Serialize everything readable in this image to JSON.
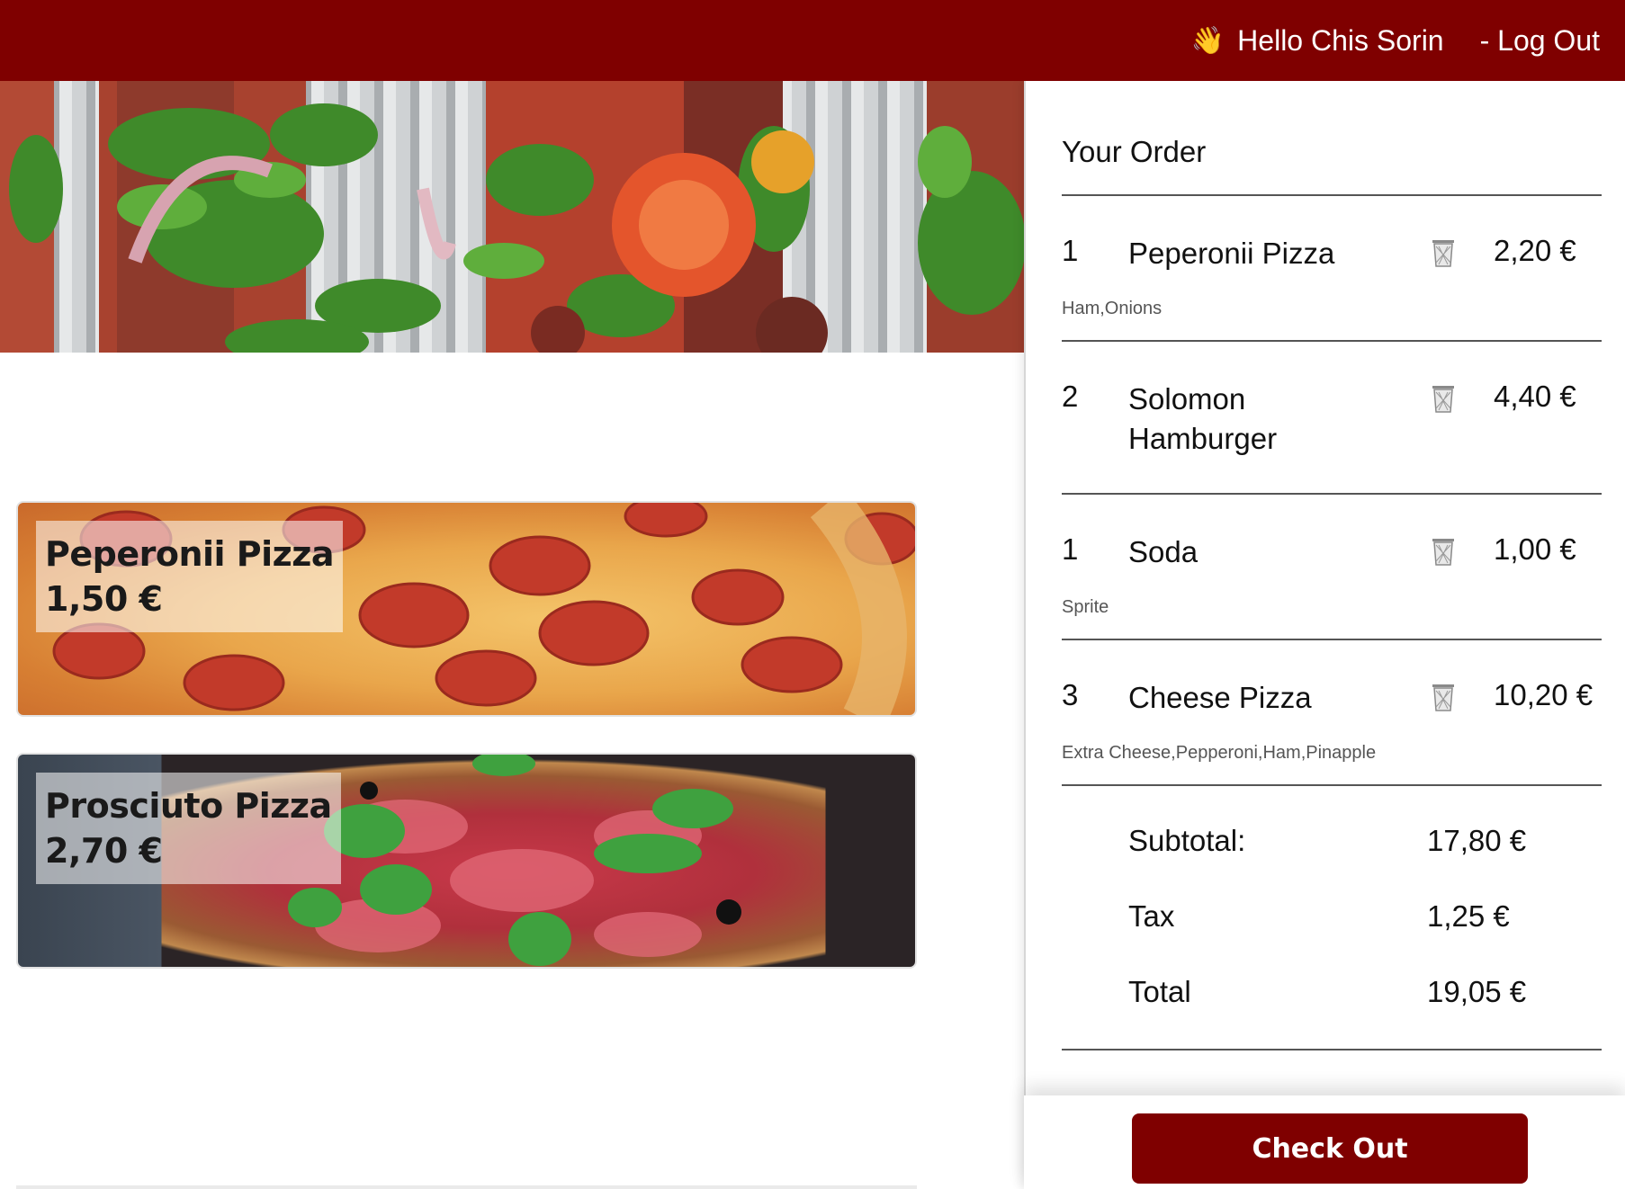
{
  "header": {
    "wave_emoji": "👋",
    "greeting": "Hello Chis Sorin",
    "logout": "- Log Out"
  },
  "menu": [
    {
      "name": "Peperonii Pizza",
      "price": "1,50 €"
    },
    {
      "name": "Prosciuto Pizza",
      "price": "2,70 €"
    }
  ],
  "order": {
    "title": "Your Order",
    "items": [
      {
        "qty": "1",
        "name": "Peperonii Pizza",
        "price": "2,20 €",
        "options": "Ham,Onions"
      },
      {
        "qty": "2",
        "name": "Solomon Hamburger",
        "price": "4,40 €",
        "options": ""
      },
      {
        "qty": "1",
        "name": "Soda",
        "price": "1,00 €",
        "options": "Sprite"
      },
      {
        "qty": "3",
        "name": "Cheese Pizza",
        "price": "10,20 €",
        "options": "Extra Cheese,Pepperoni,Ham,Pinapple"
      }
    ],
    "subtotal_label": "Subtotal:",
    "subtotal": "17,80 €",
    "tax_label": "Tax",
    "tax": "1,25 €",
    "total_label": "Total",
    "total": "19,05 €",
    "checkout_label": "Check Out"
  },
  "colors": {
    "brand": "#7f0000"
  },
  "icons": {
    "delete": "trash-icon",
    "greeting": "waving-hand-icon"
  }
}
